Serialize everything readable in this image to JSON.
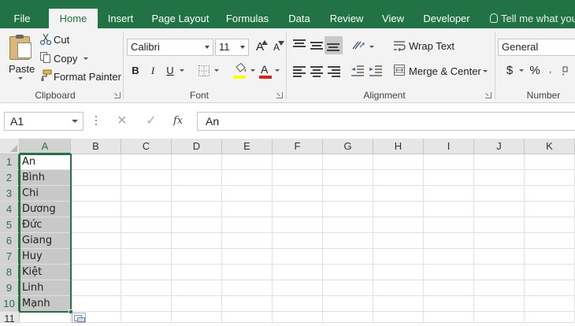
{
  "ribbon_tabs": [
    "File",
    "Home",
    "Insert",
    "Page Layout",
    "Formulas",
    "Data",
    "Review",
    "View",
    "Developer"
  ],
  "active_tab": "Home",
  "tell_me": "Tell me what you",
  "clipboard": {
    "paste": "Paste",
    "cut": "Cut",
    "copy": "Copy",
    "format_painter": "Format Painter",
    "group_label": "Clipboard"
  },
  "font": {
    "name": "Calibri",
    "size": "11",
    "bold": "B",
    "italic": "I",
    "underline": "U",
    "grow": "A",
    "shrink": "A",
    "font_color_letter": "A",
    "group_label": "Font",
    "highlight_color": "#ffff00",
    "font_color": "#e0201b"
  },
  "alignment": {
    "wrap_text": "Wrap Text",
    "merge_center": "Merge & Center",
    "group_label": "Alignment"
  },
  "number": {
    "format": "General",
    "currency": "$",
    "percent": "%",
    "group_label": "Number"
  },
  "formula_bar": {
    "name_box": "A1",
    "cancel": "✕",
    "enter": "✓",
    "fx": "fx",
    "formula": "An"
  },
  "columns": [
    "A",
    "B",
    "C",
    "D",
    "E",
    "F",
    "G",
    "H",
    "I",
    "J",
    "K"
  ],
  "rows": [
    "1",
    "2",
    "3",
    "4",
    "5",
    "6",
    "7",
    "8",
    "9",
    "10",
    "11"
  ],
  "column_a_values": [
    "An",
    "Bình",
    "Chi",
    "Dương",
    "Đức",
    "Giang",
    "Huy",
    "Kiệt",
    "Linh",
    "Mạnh"
  ],
  "colors": {
    "accent": "#217346",
    "selection_fill": "#c8c8c8"
  }
}
